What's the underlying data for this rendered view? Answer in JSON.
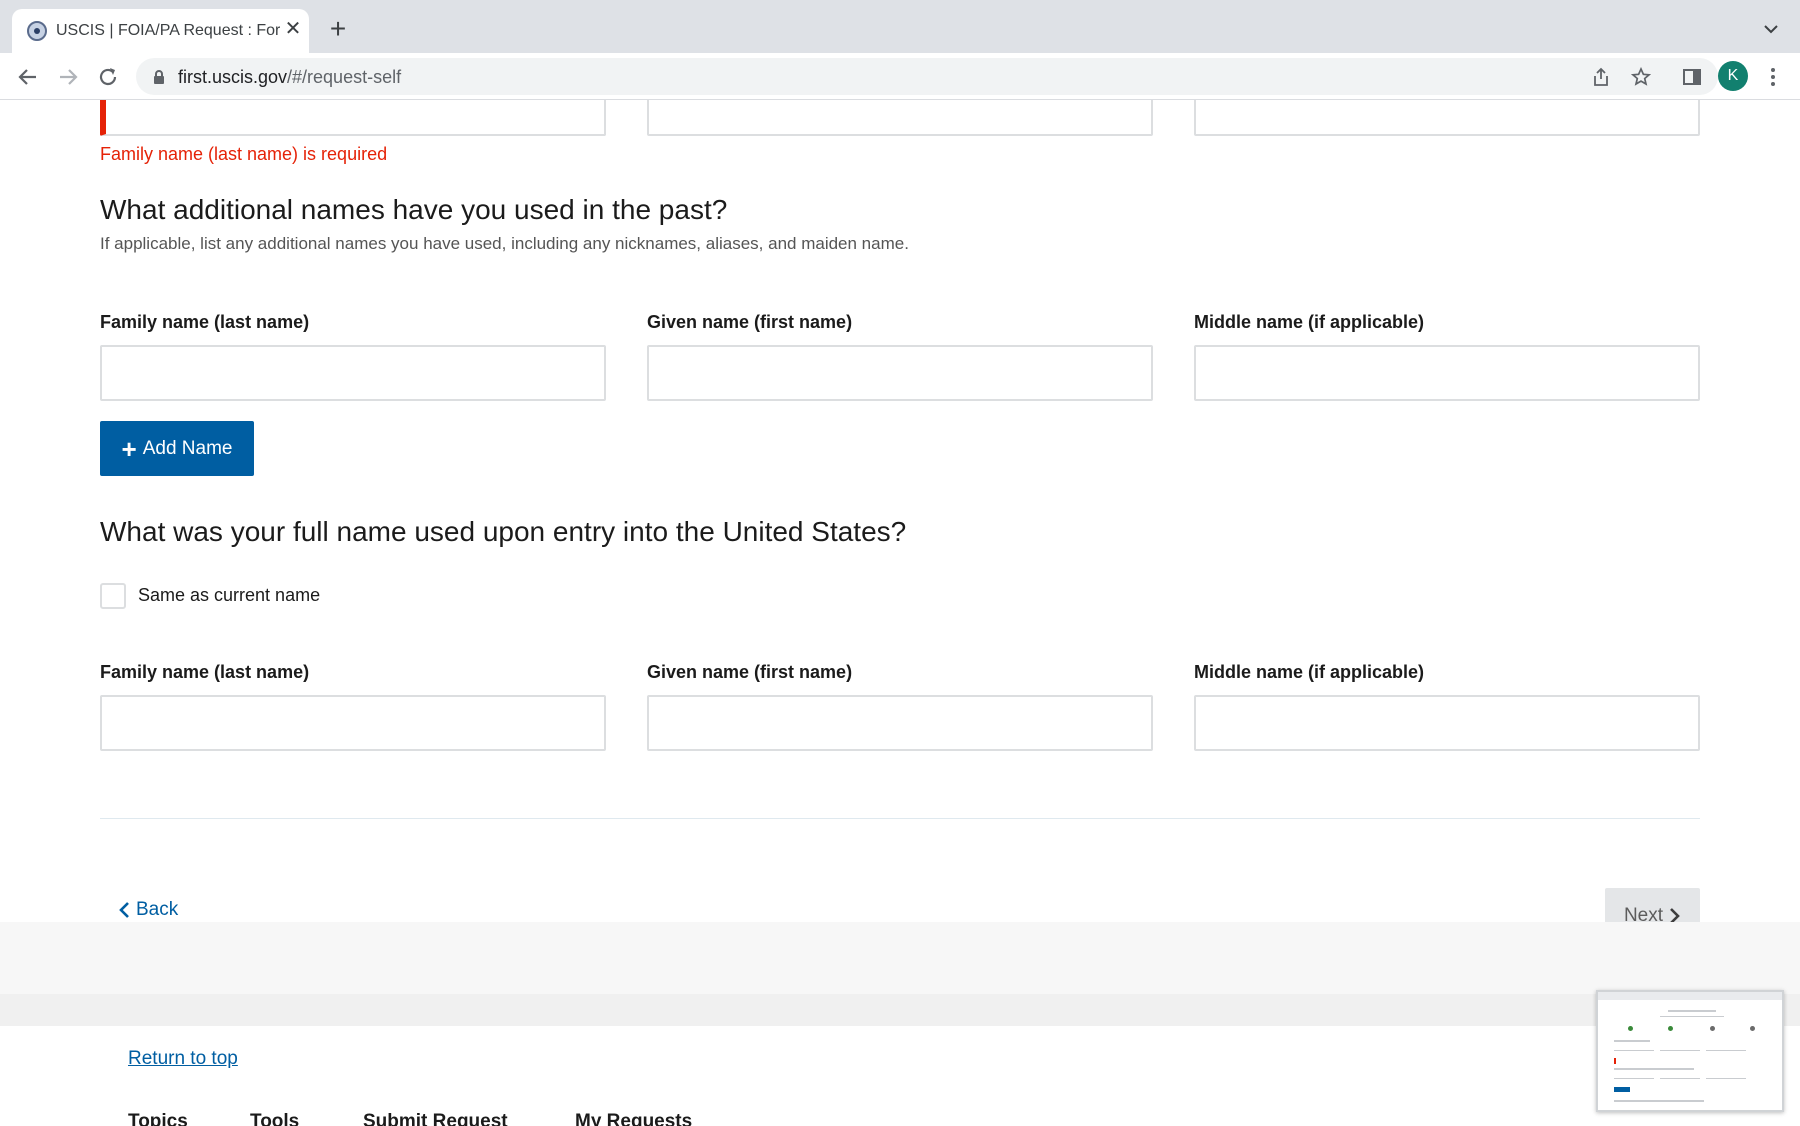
{
  "browser": {
    "tab_title": "USCIS | FOIA/PA Request : For",
    "tab_close": "✕",
    "new_tab": "+",
    "url_host": "first.uscis.gov",
    "url_path": "/#/request-self",
    "profile_initial": "K"
  },
  "form": {
    "top_error": "Family name (last name) is required",
    "additional": {
      "heading": "What additional names have you used in the past?",
      "hint": "If applicable, list any additional names you have used, including any nicknames, aliases, and maiden name.",
      "family_label": "Family name (last name)",
      "given_label": "Given name (first name)",
      "middle_label": "Middle name (if applicable)",
      "family_value": "",
      "given_value": "",
      "middle_value": "",
      "add_button": "Add Name"
    },
    "entry": {
      "heading": "What was your full name used upon entry into the United States?",
      "same_checkbox_label": "Same as current name",
      "same_checked": false,
      "family_label": "Family name (last name)",
      "given_label": "Given name (first name)",
      "middle_label": "Middle name (if applicable)",
      "family_value": "",
      "given_value": "",
      "middle_value": ""
    },
    "back_label": "Back",
    "next_label": "Next"
  },
  "footer": {
    "return_to_top": "Return to top",
    "nav": [
      "Topics",
      "Tools",
      "Submit Request",
      "My Requests"
    ]
  },
  "colors": {
    "primary": "#005ea2",
    "error": "#e52207",
    "disabled_button": "#e4e6e8",
    "avatar": "#12806f"
  }
}
